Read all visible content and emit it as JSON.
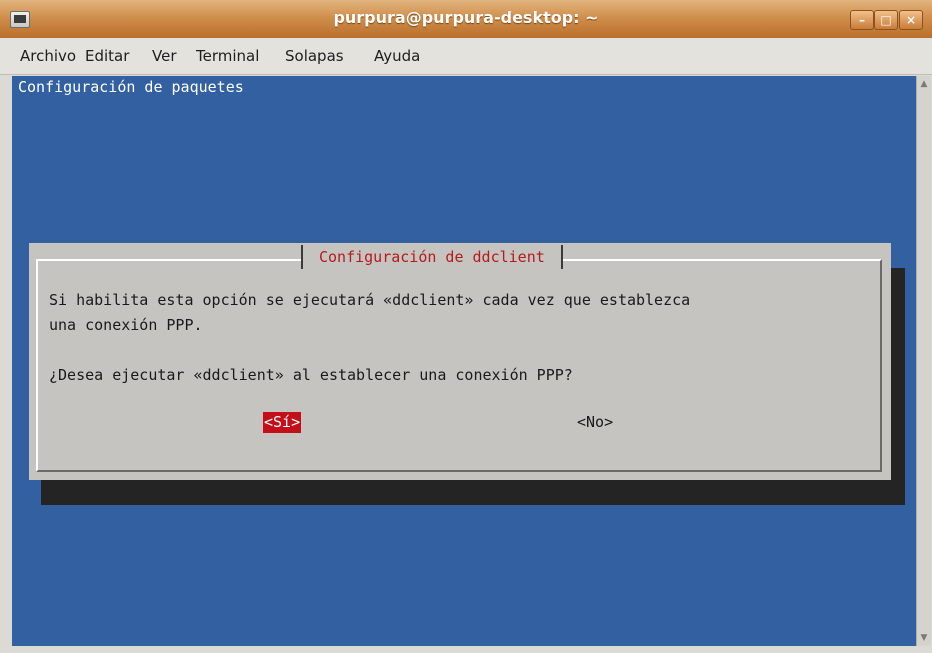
{
  "window": {
    "title": "purpura@purpura-desktop: ~",
    "minimize_glyph": "–",
    "maximize_glyph": "□",
    "close_glyph": "×"
  },
  "menu": {
    "items": [
      "Archivo",
      "Editar",
      "Ver",
      "Terminal",
      "Solapas",
      "Ayuda"
    ]
  },
  "terminal": {
    "backtitle": "Configuración de paquetes",
    "scroll_up_glyph": "▲",
    "scroll_down_glyph": "▼"
  },
  "dialog": {
    "title": "Configuración de ddclient",
    "line1": "Si habilita esta opción se ejecutará «ddclient» cada vez que establezca",
    "line2": "una conexión PPP.",
    "question": "¿Desea ejecutar «ddclient» al establecer una conexión PPP?",
    "yes_label": "<Sí>",
    "no_label": "<No>"
  },
  "colors": {
    "terminal_background": "#3260a1",
    "dialog_background": "#c6c4c0",
    "dialog_title": "#b51b1b",
    "selected_button": "#c40f1a",
    "titlebar": "#d08f4c"
  }
}
